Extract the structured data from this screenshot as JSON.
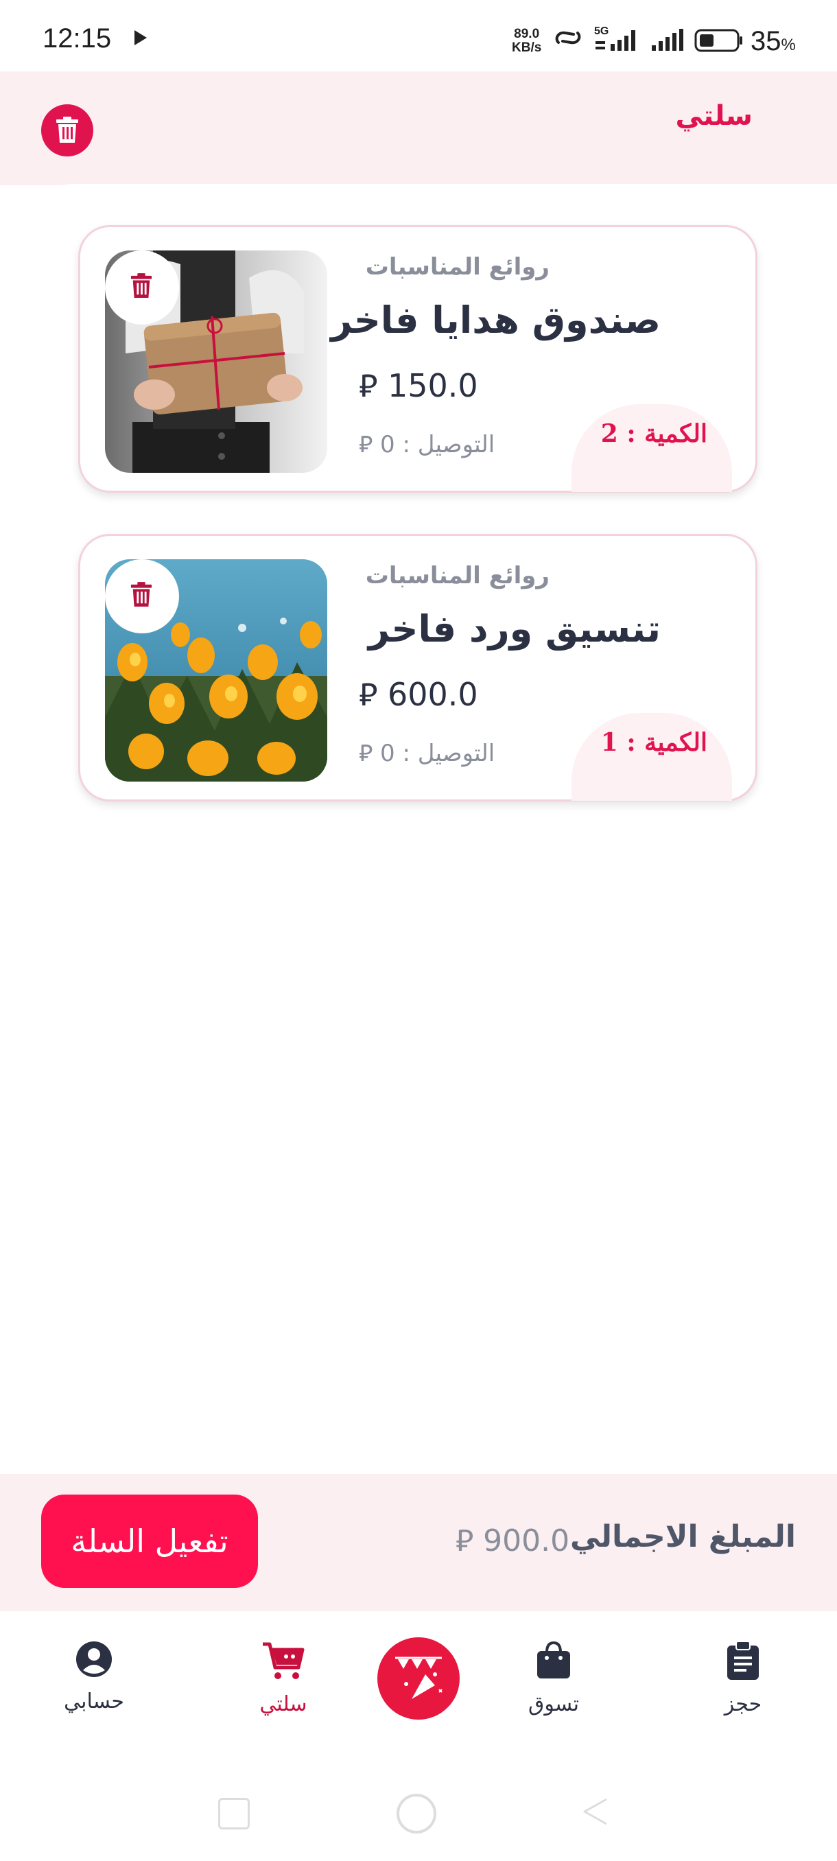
{
  "status_bar": {
    "time": "12:15",
    "net_speed_value": "89.0",
    "net_speed_unit": "KB/s",
    "network": "5G",
    "battery_percent": "35",
    "battery_symbol": "%"
  },
  "header": {
    "title": "سلتي"
  },
  "cart": {
    "items": [
      {
        "category": "روائع المناسبات",
        "name": "صندوق هدايا فاخر",
        "price": "150.0",
        "currency": "⃁",
        "delivery": "التوصيل : 0",
        "quantity": "الكمية : 2",
        "image": "gift-box-photo"
      },
      {
        "category": "روائع المناسبات",
        "name": "تنسيق ورد فاخر",
        "price": "600.0",
        "currency": "⃁",
        "delivery": "التوصيل : 0",
        "quantity": "الكمية : 1",
        "image": "yellow-flowers-photo"
      }
    ]
  },
  "checkout": {
    "total_label": "المبلغ الاجمالي",
    "total_value": "900.0",
    "button_label": "تفعيل السلة"
  },
  "bottom_nav": {
    "items": [
      {
        "label": "حسابي",
        "icon": "account-icon"
      },
      {
        "label": "سلتي",
        "icon": "cart-icon",
        "active": true
      },
      {
        "label": "",
        "icon": "celebration-icon"
      },
      {
        "label": "تسوق",
        "icon": "shopping-bag-icon"
      },
      {
        "label": "حجز",
        "icon": "booking-clipboard-icon"
      }
    ]
  },
  "colors": {
    "accent": "#e0134f",
    "button": "#ff1150",
    "header_bg": "#fbeff1",
    "text_dark": "#2b3142",
    "text_muted": "#8a8e9a"
  }
}
